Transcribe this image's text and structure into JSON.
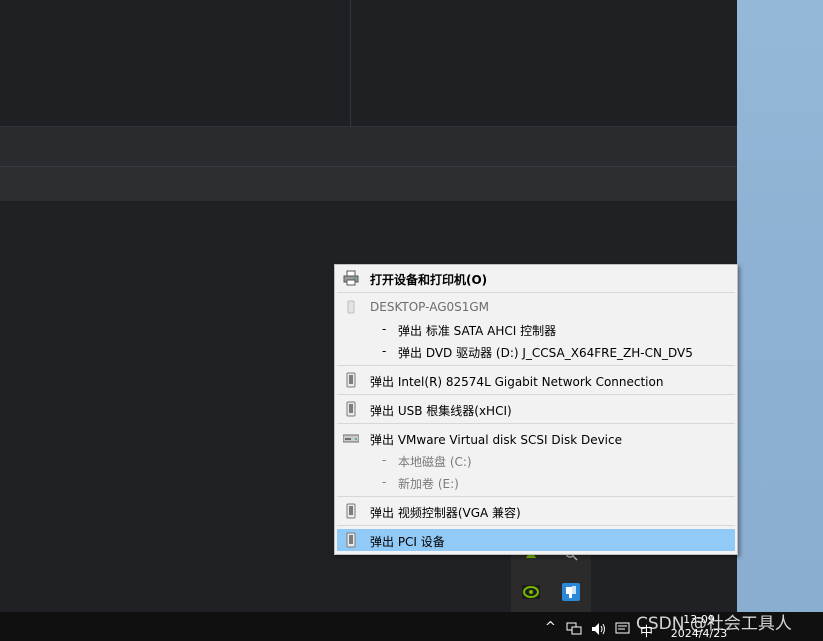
{
  "menu": {
    "open_devices": "打开设备和打印机(O)",
    "computer_name": "DESKTOP-AG0S1GM",
    "sub1": "弹出 标准 SATA AHCI 控制器",
    "sub2": "弹出 DVD 驱动器 (D:) J_CCSA_X64FRE_ZH-CN_DV5",
    "network": "弹出 Intel(R) 82574L Gigabit Network Connection",
    "usb": "弹出 USB 根集线器(xHCI)",
    "disk": "弹出 VMware Virtual disk SCSI Disk Device",
    "disk_c": "本地磁盘 (C:)",
    "disk_e": "新加卷 (E:)",
    "video": "弹出 视频控制器(VGA 兼容)",
    "pci": "弹出 PCI 设备",
    "dash": "-"
  },
  "taskbar": {
    "time": "13:09",
    "date": "2024/4/23",
    "ime": "中",
    "chevron": "^"
  },
  "watermark": "CSDN @社会工具人",
  "colors": {
    "highlight": "#91c9f7",
    "menu_bg": "#f2f2f2"
  }
}
